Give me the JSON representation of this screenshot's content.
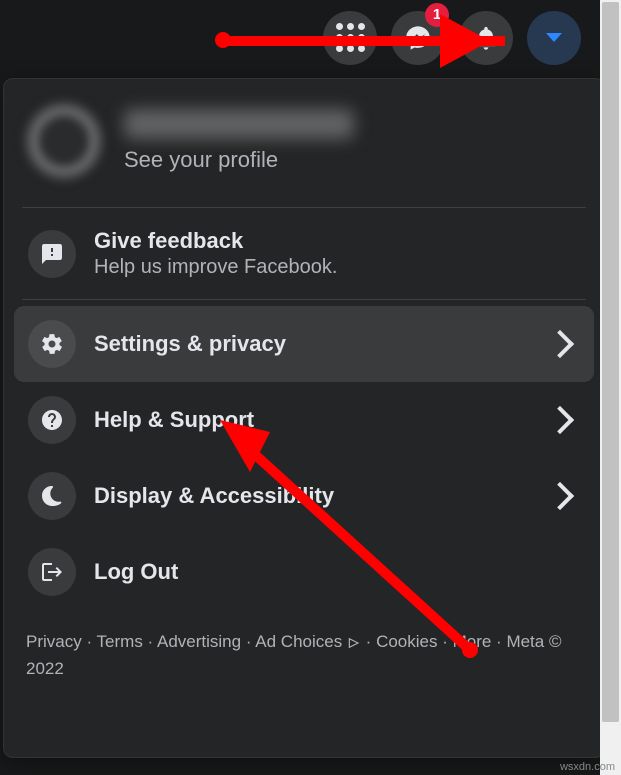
{
  "topbar": {
    "messenger_badge": "1"
  },
  "profile": {
    "subtext": "See your profile"
  },
  "menu": {
    "feedback": {
      "title": "Give feedback",
      "sub": "Help us improve Facebook."
    },
    "settings": {
      "title": "Settings & privacy"
    },
    "help": {
      "title": "Help & Support"
    },
    "display": {
      "title": "Display & Accessibility"
    },
    "logout": {
      "title": "Log Out"
    }
  },
  "footer": {
    "privacy": "Privacy",
    "terms": "Terms",
    "advertising": "Advertising",
    "ad_choices": "Ad Choices",
    "cookies": "Cookies",
    "more": "More",
    "meta": "Meta © 2022"
  },
  "watermark": "wsxdn.com"
}
